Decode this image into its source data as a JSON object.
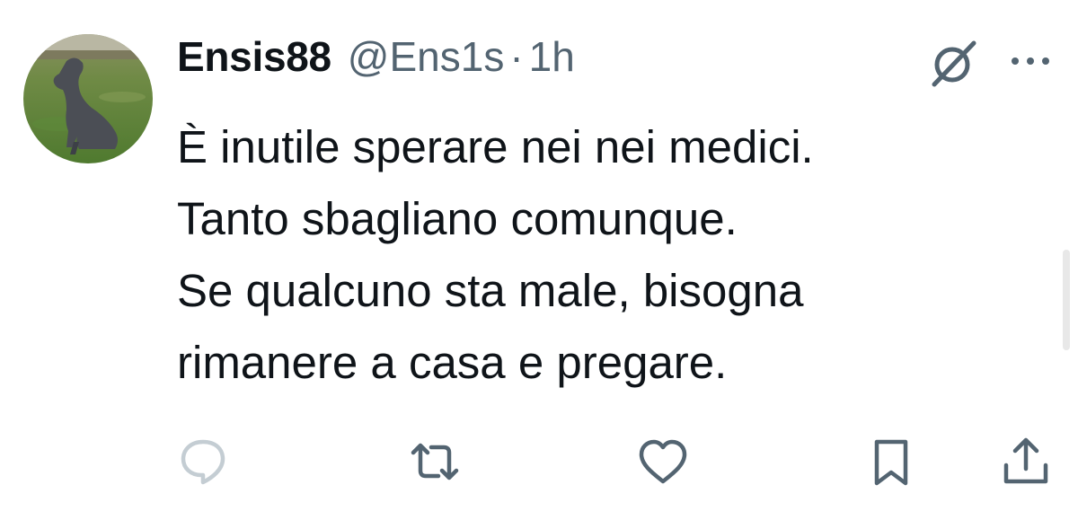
{
  "user": {
    "display_name": "Ensis88",
    "handle": "@Ens1s",
    "separator": "·",
    "time": "1h"
  },
  "tweet": {
    "lines": [
      "È inutile sperare nei nei medici.",
      "Tanto sbagliano comunque.",
      "Se qualcuno sta male, bisogna",
      "rimanere a casa e pregare."
    ]
  },
  "icons": {
    "header": [
      "grok-icon",
      "more-icon"
    ],
    "actions": [
      "reply-icon",
      "retweet-icon",
      "like-icon",
      "bookmark-icon",
      "share-icon"
    ]
  },
  "colors": {
    "text": "#0f1419",
    "secondary": "#536471",
    "background": "#ffffff"
  }
}
